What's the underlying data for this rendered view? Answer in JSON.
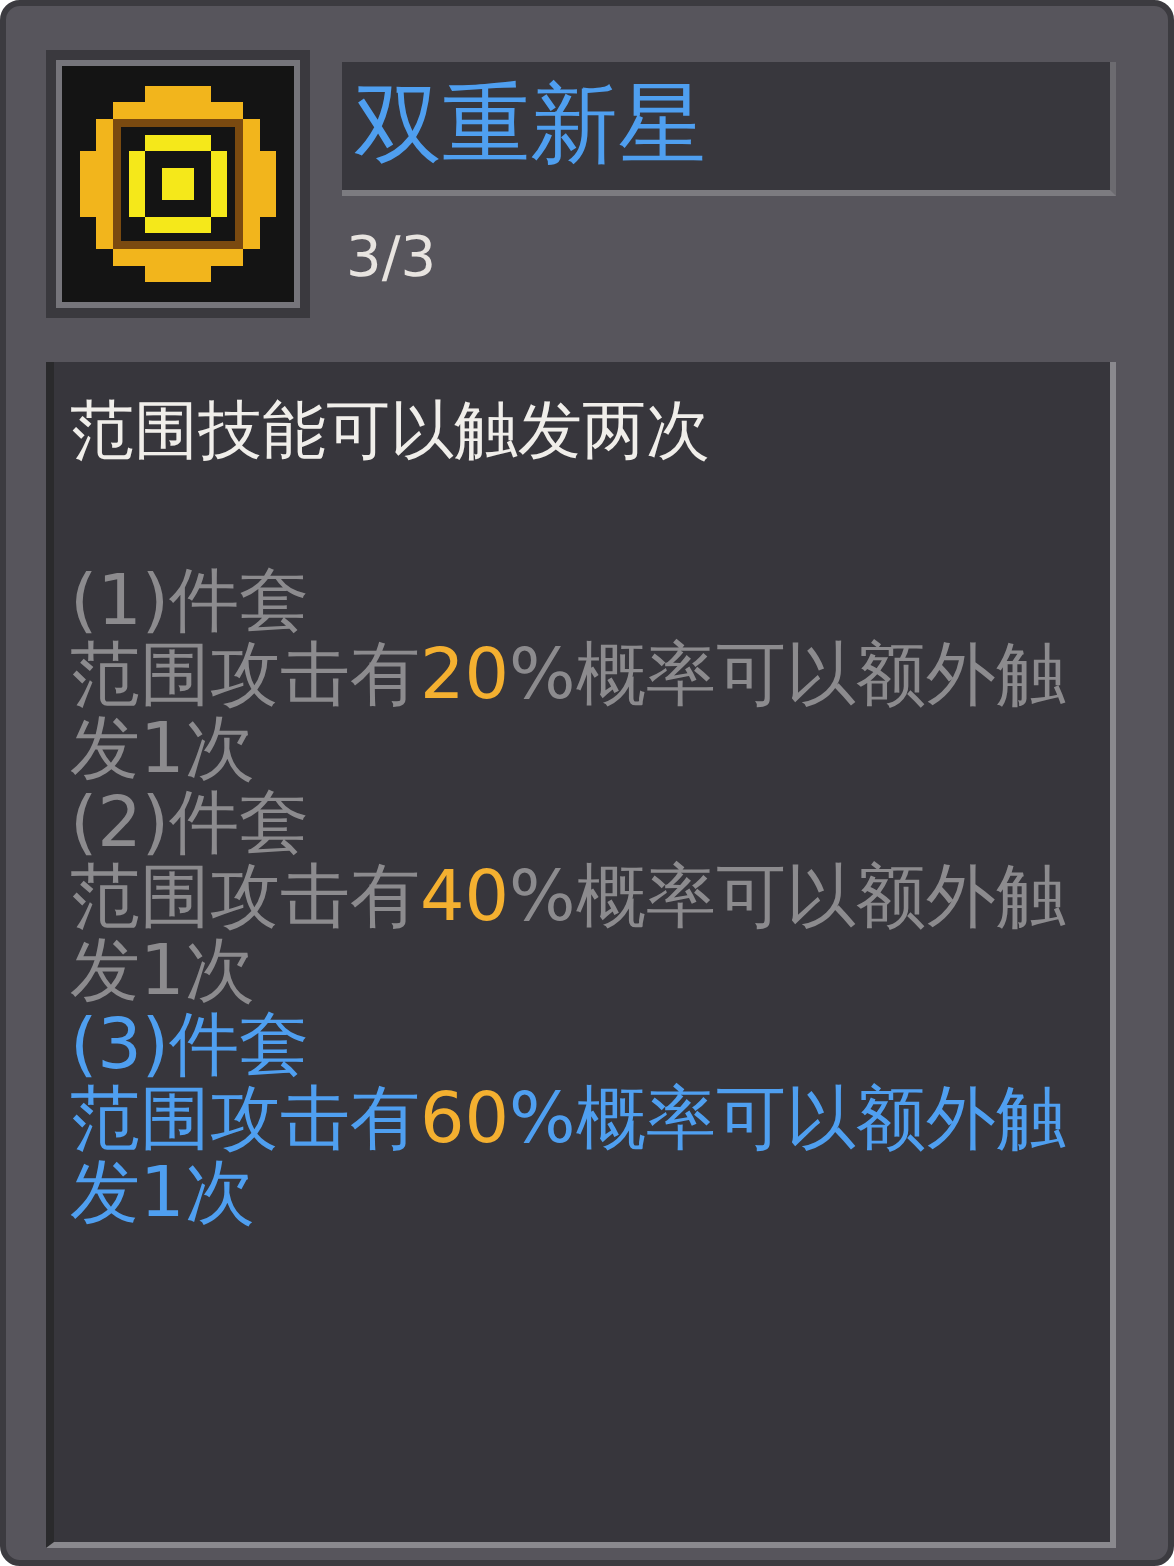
{
  "item": {
    "name": "双重新星",
    "progress": "3/3"
  },
  "description": "范围技能可以触发两次",
  "set_bonuses": [
    {
      "label": "(1)件套",
      "text_before": "范围攻击有",
      "value": "20",
      "text_after": "%概率可以额外触发1次",
      "active": false
    },
    {
      "label": "(2)件套",
      "text_before": "范围攻击有",
      "value": "40",
      "text_after": "%概率可以额外触发1次",
      "active": false
    },
    {
      "label": "(3)件套",
      "text_before": "范围攻击有",
      "value": "60",
      "text_after": "%概率可以额外触发1次",
      "active": true
    }
  ]
}
